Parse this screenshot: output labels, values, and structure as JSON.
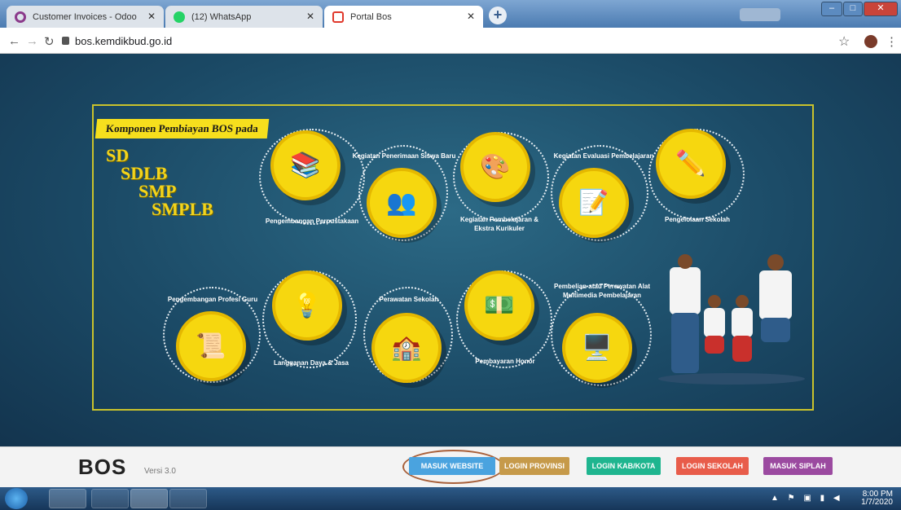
{
  "browser": {
    "tabs": [
      {
        "label": "Customer Invoices - Odoo",
        "fav_color": "#8b3a8b"
      },
      {
        "label": "(12) WhatsApp",
        "fav_color": "#25d366"
      },
      {
        "label": "Portal Bos",
        "fav_color": "#e0382c"
      }
    ],
    "new_tab": "+",
    "url": "bos.kemdikbud.go.id",
    "window_controls": [
      "–",
      "□",
      "✕"
    ]
  },
  "banner": {
    "title": "Komponen Pembiayan BOS pada",
    "levels": [
      "SD",
      "SDLB",
      "SMP",
      "SMPLB"
    ],
    "items": [
      {
        "label": "Pengembangan Perpustakaan",
        "icon": "books-icon",
        "glyph": "📚"
      },
      {
        "label": "Kegiatan Penerimaan Siswa Baru",
        "icon": "students-icon",
        "glyph": "👥"
      },
      {
        "label": "Kegiatan Pembelajaran & Ekstra Kurikuler",
        "icon": "palette-icon",
        "glyph": "🎨"
      },
      {
        "label": "Kegiatan Evaluasi Pembelajaran",
        "icon": "exam-icon",
        "glyph": "📝"
      },
      {
        "label": "Pengelolaan Sekolah",
        "icon": "stationery-icon",
        "glyph": "✏️"
      },
      {
        "label": "Pengembangan Profesi Guru",
        "icon": "certificate-icon",
        "glyph": "📜"
      },
      {
        "label": "Langganan Daya & Jasa",
        "icon": "lightbulb-icon",
        "glyph": "💡"
      },
      {
        "label": "Perawatan Sekolah",
        "icon": "school-icon",
        "glyph": "🏫"
      },
      {
        "label": "Pembayaran Honor",
        "icon": "money-icon",
        "glyph": "💵"
      },
      {
        "label": "Pembelian atau Perawatan Alat Multimedia Pembelajaran",
        "icon": "computer-icon",
        "glyph": "🖥️"
      }
    ]
  },
  "footer": {
    "logo": "BOS",
    "version": "Versi 3.0",
    "buttons": [
      {
        "label": "MASUK WEBSITE",
        "color": "#4aa3df"
      },
      {
        "label": "LOGIN PROVINSI",
        "color": "#c69a4a"
      },
      {
        "label": "LOGIN KAB/KOTA",
        "color": "#1fb58f"
      },
      {
        "label": "LOGIN SEKOLAH",
        "color": "#e85c4a"
      },
      {
        "label": "MASUK SIPLAH",
        "color": "#9b4aa0"
      }
    ]
  },
  "taskbar": {
    "time": "8:00 PM",
    "date": "1/7/2020"
  }
}
